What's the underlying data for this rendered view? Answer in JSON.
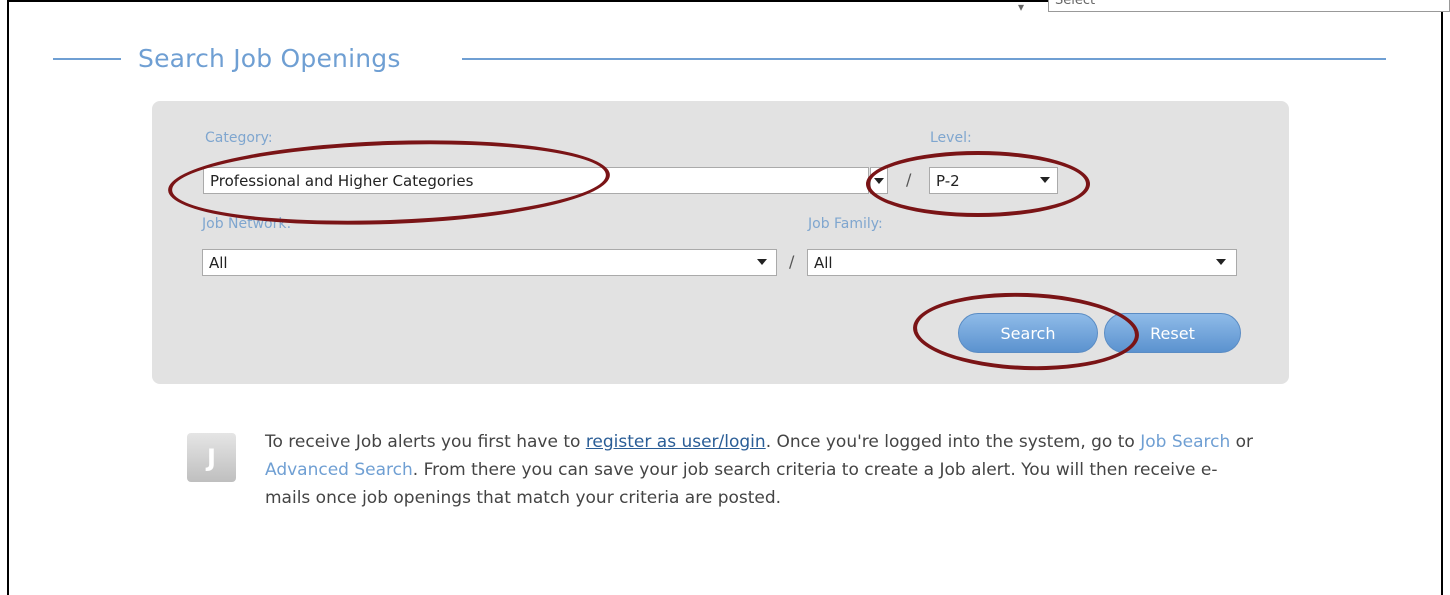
{
  "top_select": {
    "value": "Select"
  },
  "legend": {
    "title": "Search Job Openings"
  },
  "form": {
    "category": {
      "label": "Category:",
      "value": "Professional and Higher Categories"
    },
    "level": {
      "label": "Level:",
      "value": "P-2"
    },
    "job_network": {
      "label": "Job Network:",
      "value": "All"
    },
    "job_family": {
      "label": "Job Family:",
      "value": "All"
    },
    "separator": "/",
    "search_label": "Search",
    "reset_label": "Reset"
  },
  "info": {
    "icon_letter": "J",
    "part1": "To receive Job alerts you first have to ",
    "register_link": "register as user/login",
    "part2": ". Once you're logged into the system, go to ",
    "job_search_link": "Job Search",
    "part3": " or ",
    "advanced_search_link": "Advanced Search",
    "part4": ". From there you can save your job search criteria to create a Job alert. You will then receive e-mails once job openings that match your criteria are posted."
  },
  "colors": {
    "accent": "#6f9fd3",
    "annotation": "#7a1416",
    "panel": "#e2e2e2"
  }
}
